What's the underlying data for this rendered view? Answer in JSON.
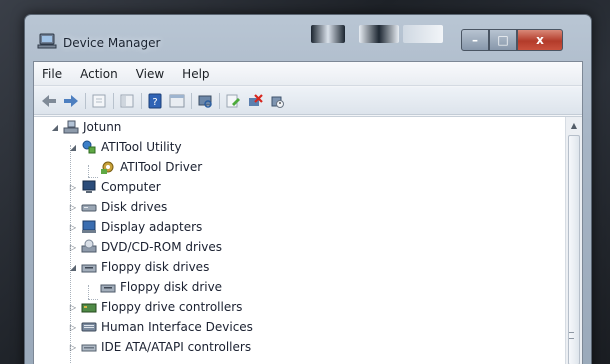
{
  "window": {
    "title": "Device Manager",
    "controls": {
      "minimize_label": "–",
      "maximize_label": "□",
      "close_label": "x"
    }
  },
  "menubar": {
    "items": [
      {
        "label": "File"
      },
      {
        "label": "Action"
      },
      {
        "label": "View"
      },
      {
        "label": "Help"
      }
    ]
  },
  "toolbar": {
    "buttons": [
      {
        "icon": "back-arrow-icon"
      },
      {
        "icon": "forward-arrow-icon"
      },
      {
        "icon": "properties-icon"
      },
      {
        "icon": "show-hide-console-tree-icon"
      },
      {
        "icon": "help-icon"
      },
      {
        "icon": "console-window-icon"
      },
      {
        "icon": "scan-hardware-changes-icon"
      },
      {
        "icon": "update-driver-icon"
      },
      {
        "icon": "uninstall-icon"
      },
      {
        "icon": "disable-device-icon"
      }
    ]
  },
  "tree": {
    "root": {
      "label": "Jotunn",
      "icon": "computer-icon",
      "expanded": true
    },
    "nodes": [
      {
        "label": "ATITool Utility",
        "icon": "atitool-icon",
        "expanded": true,
        "children": [
          {
            "label": "ATITool Driver",
            "icon": "driver-gear-icon"
          }
        ]
      },
      {
        "label": "Computer",
        "icon": "monitor-icon",
        "expanded": false
      },
      {
        "label": "Disk drives",
        "icon": "disk-drive-icon",
        "expanded": false
      },
      {
        "label": "Display adapters",
        "icon": "display-adapter-icon",
        "expanded": false
      },
      {
        "label": "DVD/CD-ROM drives",
        "icon": "dvd-drive-icon",
        "expanded": false
      },
      {
        "label": "Floppy disk drives",
        "icon": "floppy-drive-icon",
        "expanded": true,
        "children": [
          {
            "label": "Floppy disk drive",
            "icon": "floppy-drive-icon"
          }
        ]
      },
      {
        "label": "Floppy drive controllers",
        "icon": "floppy-controller-icon",
        "expanded": false
      },
      {
        "label": "Human Interface Devices",
        "icon": "hid-icon",
        "expanded": false
      },
      {
        "label": "IDE ATA/ATAPI controllers",
        "icon": "ide-controller-icon",
        "expanded": false
      }
    ]
  },
  "colors": {
    "frame": "#a8b6c6",
    "close_button": "#c24a37",
    "tree_background": "#ffffff"
  }
}
